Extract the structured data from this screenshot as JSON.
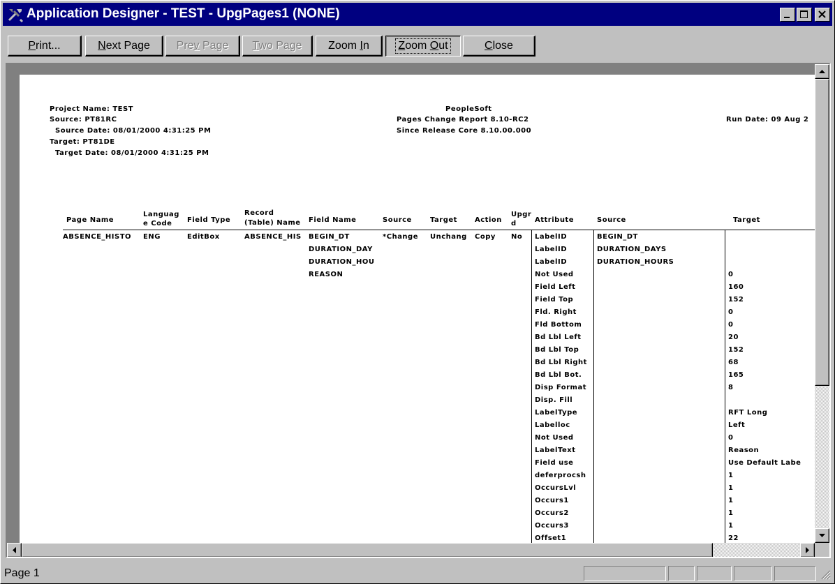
{
  "window": {
    "title": "Application Designer - TEST - UpgPages1 (NONE)"
  },
  "toolbar": {
    "buttons": [
      {
        "label": "Print...",
        "state": "normal"
      },
      {
        "label": "Next Page",
        "state": "normal"
      },
      {
        "label": "Prev Page",
        "state": "disabled"
      },
      {
        "label": "Two Page",
        "state": "disabled"
      },
      {
        "label": "Zoom In",
        "state": "normal"
      },
      {
        "label": "Zoom Out",
        "state": "pressed"
      },
      {
        "label": "Close",
        "state": "normal"
      }
    ]
  },
  "report": {
    "project_name": "Project Name: TEST",
    "source": "Source: PT81RC",
    "source_date": "Source Date: 08/01/2000 4:31:25 PM",
    "target": "Target: PT81DE",
    "target_date": "Target Date: 08/01/2000 4:31:25 PM",
    "company": "PeopleSoft",
    "report_title": "Pages Change Report 8.10-RC2",
    "since_release": "Since Release Core 8.10.00.000",
    "run_date": "Run Date: 09 Aug 2",
    "columns": {
      "page_name": "Page Name",
      "language_code_1": "Languag",
      "language_code_2": "e Code",
      "field_type": "Field Type",
      "record_name_1": "Record",
      "record_name_2": "(Table) Name",
      "field_name": "Field Name",
      "source": "Source",
      "target": "Target",
      "action": "Action",
      "upgrade_1": "Upgr",
      "upgrade_2": "d",
      "attribute": "Attribute",
      "attr_source": "Source",
      "attr_target": "Target"
    },
    "row": {
      "page_name": "ABSENCE_HISTO",
      "language_code": "ENG",
      "field_type": "EditBox",
      "record_name": "ABSENCE_HIS",
      "source": "*Change",
      "target": "Unchang",
      "action": "Copy",
      "upgrade": "No"
    },
    "field_names": [
      "BEGIN_DT",
      "DURATION_DAY",
      "DURATION_HOU",
      "REASON"
    ],
    "attributes": [
      {
        "name": "LabelID",
        "source": "BEGIN_DT",
        "target": ""
      },
      {
        "name": "LabelID",
        "source": "DURATION_DAYS",
        "target": ""
      },
      {
        "name": "LabelID",
        "source": "DURATION_HOURS",
        "target": ""
      },
      {
        "name": "Not Used",
        "source": "",
        "target": "0"
      },
      {
        "name": "Field Left",
        "source": "",
        "target": "160"
      },
      {
        "name": "Field Top",
        "source": "",
        "target": "152"
      },
      {
        "name": "Fld. Right",
        "source": "",
        "target": "0"
      },
      {
        "name": "Fld Bottom",
        "source": "",
        "target": "0"
      },
      {
        "name": "Bd Lbl Left",
        "source": "",
        "target": "20"
      },
      {
        "name": "Bd Lbl Top",
        "source": "",
        "target": "152"
      },
      {
        "name": "Bd Lbl Right",
        "source": "",
        "target": "68"
      },
      {
        "name": "Bd Lbl Bot.",
        "source": "",
        "target": "165"
      },
      {
        "name": "Disp Format",
        "source": "",
        "target": "8"
      },
      {
        "name": "Disp. Fill",
        "source": "",
        "target": ""
      },
      {
        "name": "LabelType",
        "source": "",
        "target": "RFT Long"
      },
      {
        "name": "Labelloc",
        "source": "",
        "target": "Left"
      },
      {
        "name": "Not Used",
        "source": "",
        "target": "0"
      },
      {
        "name": "LabelText",
        "source": "",
        "target": "Reason"
      },
      {
        "name": "Field use",
        "source": "",
        "target": "Use Default Labe"
      },
      {
        "name": "deferprocsh",
        "source": "",
        "target": "1"
      },
      {
        "name": "OccursLvl",
        "source": "",
        "target": "1"
      },
      {
        "name": "Occurs1",
        "source": "",
        "target": "1"
      },
      {
        "name": "Occurs2",
        "source": "",
        "target": "1"
      },
      {
        "name": "Occurs3",
        "source": "",
        "target": "1"
      },
      {
        "name": "Offset1",
        "source": "",
        "target": "22"
      }
    ]
  },
  "status": {
    "page": "Page 1"
  }
}
